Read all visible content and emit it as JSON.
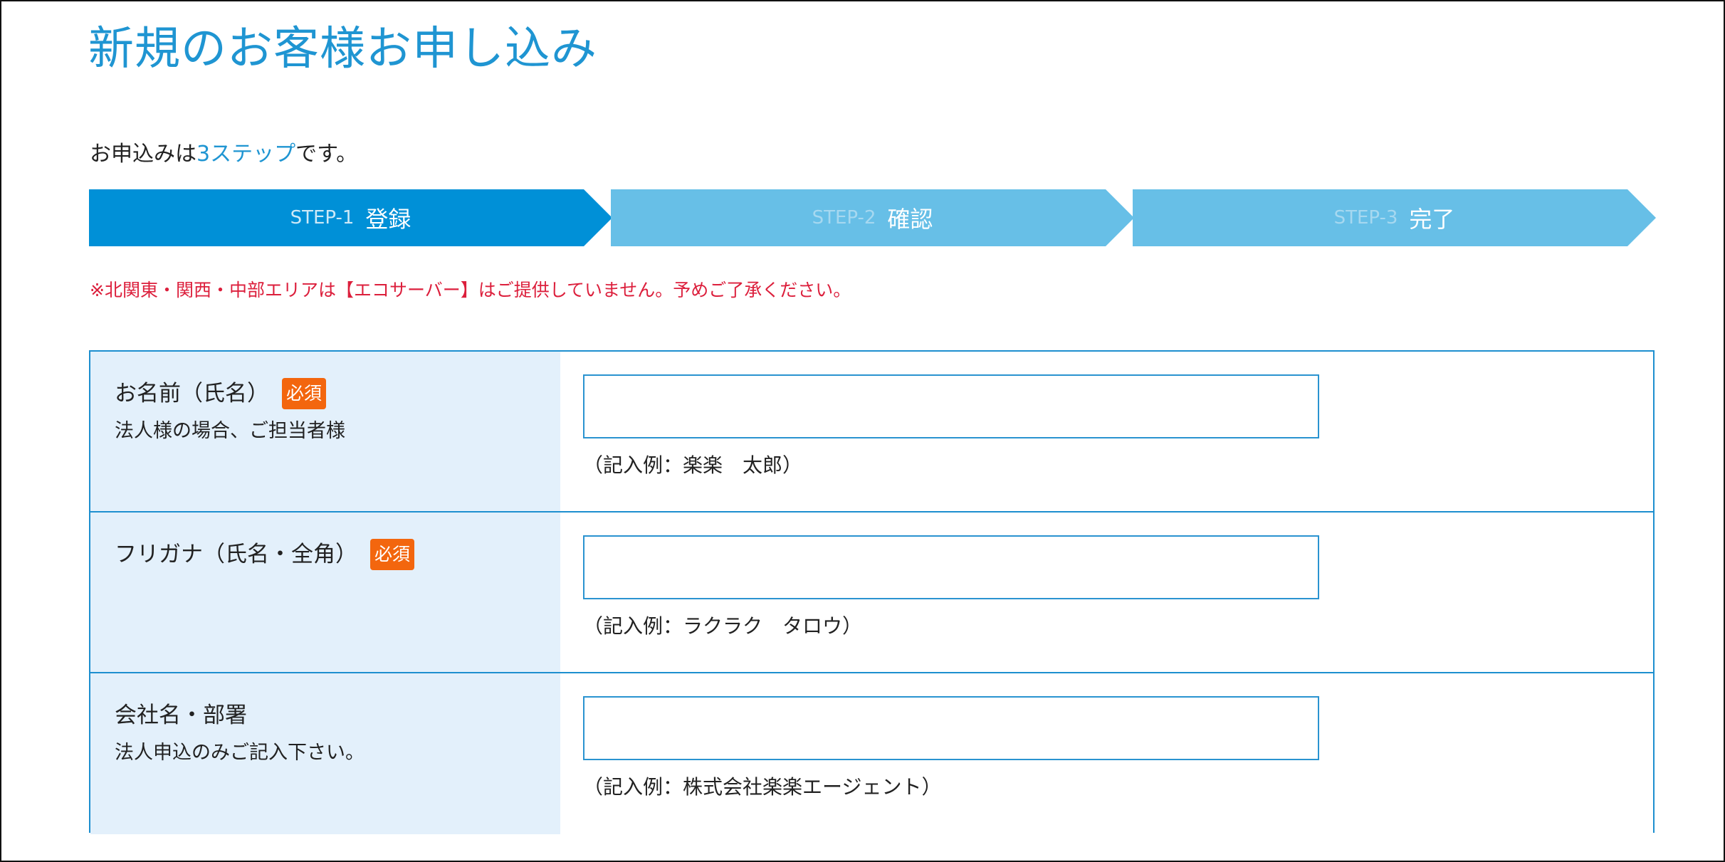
{
  "page": {
    "title": "新規のお客様お申し込み",
    "intro_before": "お申込みは",
    "intro_accent": "3ステップ",
    "intro_after": "です。"
  },
  "steps": [
    {
      "num": "STEP-1",
      "name": "登録",
      "state": "active"
    },
    {
      "num": "STEP-2",
      "name": "確認",
      "state": "inactive"
    },
    {
      "num": "STEP-3",
      "name": "完了",
      "state": "inactive"
    }
  ],
  "notice": "※北関東・関西・中部エリアは【エコサーバー】はご提供していません。予めご了承ください。",
  "form": {
    "rows": [
      {
        "label": "お名前（氏名）",
        "required": "必須",
        "sub": "法人様の場合、ご担当者様",
        "value": "",
        "example": "（記入例：楽楽　太郎）"
      },
      {
        "label": "フリガナ（氏名・全角）",
        "required": "必須",
        "sub": "",
        "value": "",
        "example": "（記入例：ラクラク　タロウ）"
      },
      {
        "label": "会社名・部署",
        "required": "",
        "sub": "法人申込のみご記入下さい。",
        "value": "",
        "example": "（記入例：株式会社楽楽エージェント）"
      }
    ]
  },
  "colors": {
    "accent": "#1f95d2",
    "step_active": "#0090d7",
    "step_inactive": "#67bfe7",
    "notice": "#dc1f3c",
    "required_badge": "#f3660e",
    "label_bg": "#e3f0fb",
    "border": "#1d8fcf"
  }
}
